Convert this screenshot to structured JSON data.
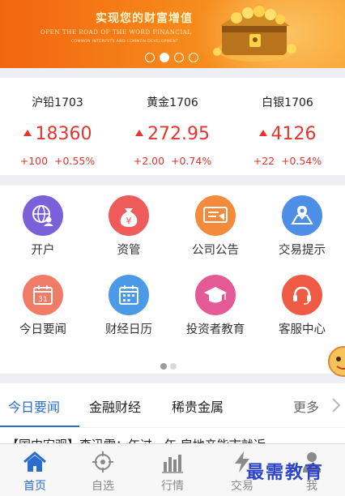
{
  "banner": {
    "title": "实现您的财富增值",
    "subtitle": "OPEN THE ROAD OF THE WORD FINANCIAL",
    "subtitle2": "COMMON INTERESTS AND COMMON DEVELOPMENT",
    "slides": 4,
    "active_slide": 1
  },
  "quotes": [
    {
      "name": "沪铅1703",
      "price": "18360",
      "change": "+100",
      "pct": "+0.55%"
    },
    {
      "name": "黄金1706",
      "price": "272.95",
      "change": "+2.00",
      "pct": "+0.74%"
    },
    {
      "name": "白银1706",
      "price": "4126",
      "change": "+22",
      "pct": "+0.54%"
    }
  ],
  "grid": [
    {
      "label": "开户",
      "icon": "globe-user-icon",
      "color": "#7b61d9"
    },
    {
      "label": "资管",
      "icon": "money-bag-icon",
      "color": "#ef5a5a"
    },
    {
      "label": "公司公告",
      "icon": "announcement-icon",
      "color": "#f48a3c"
    },
    {
      "label": "交易提示",
      "icon": "map-pin-icon",
      "color": "#4d8ee6"
    },
    {
      "label": "今日要闻",
      "icon": "calendar-31-icon",
      "color": "#f07b66"
    },
    {
      "label": "财经日历",
      "icon": "calendar-grid-icon",
      "color": "#4a9ae8"
    },
    {
      "label": "投资者教育",
      "icon": "graduation-cap-icon",
      "color": "#e45a96"
    },
    {
      "label": "客服中心",
      "icon": "headset-icon",
      "color": "#ef5a45"
    }
  ],
  "tabs": {
    "items": [
      "今日要闻",
      "金融财经",
      "稀贵金属"
    ],
    "more": "更多"
  },
  "headline": "【国内宏观】李迅雷：年过一年 房地产能市就近",
  "bottom_nav": [
    {
      "label": "首页",
      "icon": "home-icon"
    },
    {
      "label": "自选",
      "icon": "crosshair-icon"
    },
    {
      "label": "行情",
      "icon": "bar-chart-icon"
    },
    {
      "label": "交易",
      "icon": "lightning-icon"
    },
    {
      "label": "我",
      "icon": "person-icon"
    }
  ],
  "watermark": "最需教育",
  "colors": {
    "accent": "#2a6dcf",
    "up": "#e6342f",
    "banner_start": "#f2650f",
    "banner_end": "#f9a533"
  }
}
